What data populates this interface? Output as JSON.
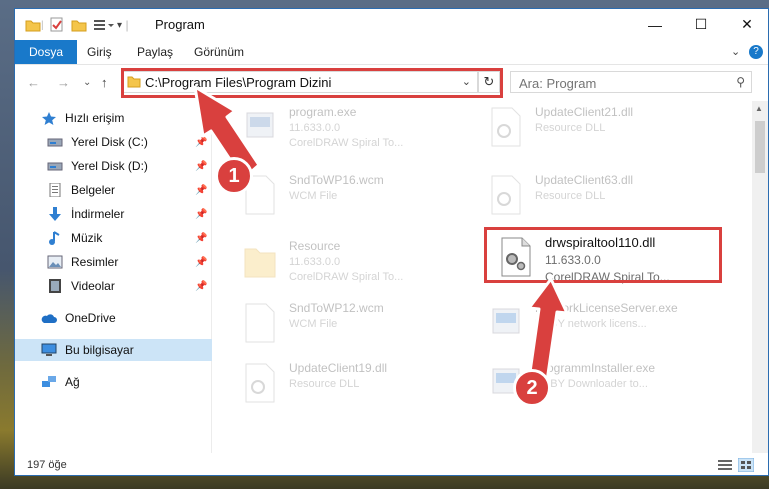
{
  "window": {
    "title": "Program",
    "minimize": "—",
    "maximize": "☐",
    "close": "✕"
  },
  "ribbon": {
    "tabs": [
      "Dosya",
      "Giriş",
      "Paylaş",
      "Görünüm"
    ],
    "help": "?",
    "collapse": "⌄"
  },
  "nav": {
    "back": "←",
    "forward": "→",
    "recent": "⌄",
    "up": "↑",
    "address": "C:\\Program Files\\Program Dizini",
    "address_dropdown": "⌄",
    "refresh": "↻",
    "search_placeholder": "Ara: Program",
    "search_icon": "⚲"
  },
  "sidebar": {
    "items": [
      {
        "label": "Hızlı erişim",
        "icon": "star-icon"
      },
      {
        "label": "Yerel Disk (C:)",
        "icon": "drive-icon",
        "pinned": true
      },
      {
        "label": "Yerel Disk (D:)",
        "icon": "drive-icon",
        "pinned": true
      },
      {
        "label": "Belgeler",
        "icon": "documents-icon",
        "pinned": true
      },
      {
        "label": "İndirmeler",
        "icon": "download-icon",
        "pinned": true
      },
      {
        "label": "Müzik",
        "icon": "music-icon",
        "pinned": true
      },
      {
        "label": "Resimler",
        "icon": "pictures-icon",
        "pinned": true
      },
      {
        "label": "Videolar",
        "icon": "videos-icon",
        "pinned": true
      },
      {
        "label": "OneDrive",
        "icon": "cloud-icon"
      },
      {
        "label": "Bu bilgisayar",
        "icon": "computer-icon",
        "selected": true
      },
      {
        "label": "Ağ",
        "icon": "network-icon"
      }
    ],
    "pin_glyph": "📌"
  },
  "files": [
    {
      "name": "program.exe",
      "line2": "11.633.0.0",
      "line3": "CorelDRAW Spiral To...",
      "icon": "exe-icon"
    },
    {
      "name": "UpdateClient21.dll",
      "line2": "Resource DLL",
      "line3": "",
      "icon": "dll-icon"
    },
    {
      "name": "SndToWP16.wcm",
      "line2": "WCM File",
      "line3": "",
      "icon": "file-icon"
    },
    {
      "name": "UpdateClient63.dll",
      "line2": "Resource DLL",
      "line3": "",
      "icon": "dll-icon"
    },
    {
      "name": "Resource",
      "line2": "11.633.0.0",
      "line3": "CorelDRAW Spiral To...",
      "icon": "folder-icon"
    },
    {
      "name": "drwspiraltool110.dll",
      "line2": "11.633.0.0",
      "line3": "CorelDRAW Spiral To...",
      "icon": "dll-icon",
      "highlighted": true
    },
    {
      "name": "SndToWP12.wcm",
      "line2": "WCM File",
      "line3": "",
      "icon": "file-icon"
    },
    {
      "name": "NetworkLicenseServer.exe",
      "line2": "NBBY network licens...",
      "line3": "",
      "icon": "exe-icon"
    },
    {
      "name": "UpdateClient19.dll",
      "line2": "Resource DLL",
      "line3": "",
      "icon": "dll-icon"
    },
    {
      "name": "ProgrammInstaller.exe",
      "line2": "NBBY Downloader to...",
      "line3": "",
      "icon": "exe-icon"
    }
  ],
  "status": {
    "count": "197 öğe"
  },
  "annotations": {
    "step1": "1",
    "step2": "2",
    "color": "#d9403e"
  }
}
